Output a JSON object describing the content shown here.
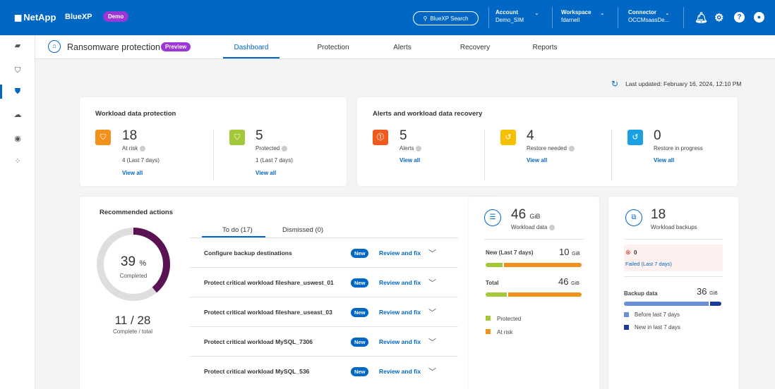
{
  "topbar": {
    "brand": "NetApp",
    "product": "BlueXP",
    "demo_badge": "Demo",
    "search_label": "BlueXP Search",
    "account": {
      "title": "Account",
      "value": "Demo_SIM"
    },
    "workspace": {
      "title": "Workspace",
      "value": "fdarnell"
    },
    "connector": {
      "title": "Connector",
      "value": "OCCMsaasDe..."
    }
  },
  "subheader": {
    "title": "Ransomware protection",
    "badge": "Preview",
    "tabs": [
      "Dashboard",
      "Protection",
      "Alerts",
      "Recovery",
      "Reports"
    ],
    "active_tab": "Dashboard"
  },
  "last_updated": "Last updated: February 16, 2024, 12:10 PM",
  "workload_protection": {
    "title": "Workload data protection",
    "at_risk": {
      "value": "18",
      "label": "At risk",
      "sub": "4 (Last 7 days)",
      "link": "View all"
    },
    "protected": {
      "value": "5",
      "label": "Protected",
      "sub": "1 (Last 7 days)",
      "link": "View all"
    }
  },
  "alerts_recovery": {
    "title": "Alerts and workload data recovery",
    "alerts": {
      "value": "5",
      "label": "Alerts",
      "link": "View all"
    },
    "restore_needed": {
      "value": "4",
      "label": "Restore needed",
      "link": "View all"
    },
    "restore_in_progress": {
      "value": "0",
      "label": "Restore in progress",
      "link": "View all"
    }
  },
  "recommended": {
    "title": "Recommended actions",
    "percent": "39",
    "percent_unit": "%",
    "percent_value": 39,
    "percent_label": "Completed",
    "ratio": "11 / 28",
    "ratio_label": "Complete / total",
    "tabs": [
      "To do (17)",
      "Dismissed (0)"
    ],
    "new_label": "New",
    "action_label": "Review and fix",
    "items": [
      "Configure backup destinations",
      "Protect critical workload fileshare_uswest_01",
      "Protect critical workload fileshare_useast_03",
      "Protect critical workload MySQL_7306",
      "Protect critical workload MySQL_536"
    ]
  },
  "workload_data": {
    "value": "46",
    "unit": "GiB",
    "label": "Workload data",
    "new_label": "New (Last 7 days)",
    "new_value": "10",
    "new_unit": "GiB",
    "new_protected_fraction": 0.18,
    "total_label": "Total",
    "total_value": "46",
    "total_unit": "GiB",
    "total_protected_fraction": 0.22,
    "legend": [
      "Protected",
      "At risk"
    ],
    "colors": {
      "protected": "#a3c93a",
      "at_risk": "#f0921c"
    }
  },
  "workload_backups": {
    "value": "18",
    "label": "Workload backups",
    "failed_count": "0",
    "failed_label": "Failed (Last 7 days)",
    "backup_data_label": "Backup data",
    "backup_data_value": "36",
    "backup_data_unit": "GiB",
    "before_fraction": 0.87,
    "legend": [
      "Before last 7 days",
      "New in last 7 days"
    ],
    "colors": {
      "before": "#6a8fd4",
      "new": "#1a3a9c"
    }
  }
}
